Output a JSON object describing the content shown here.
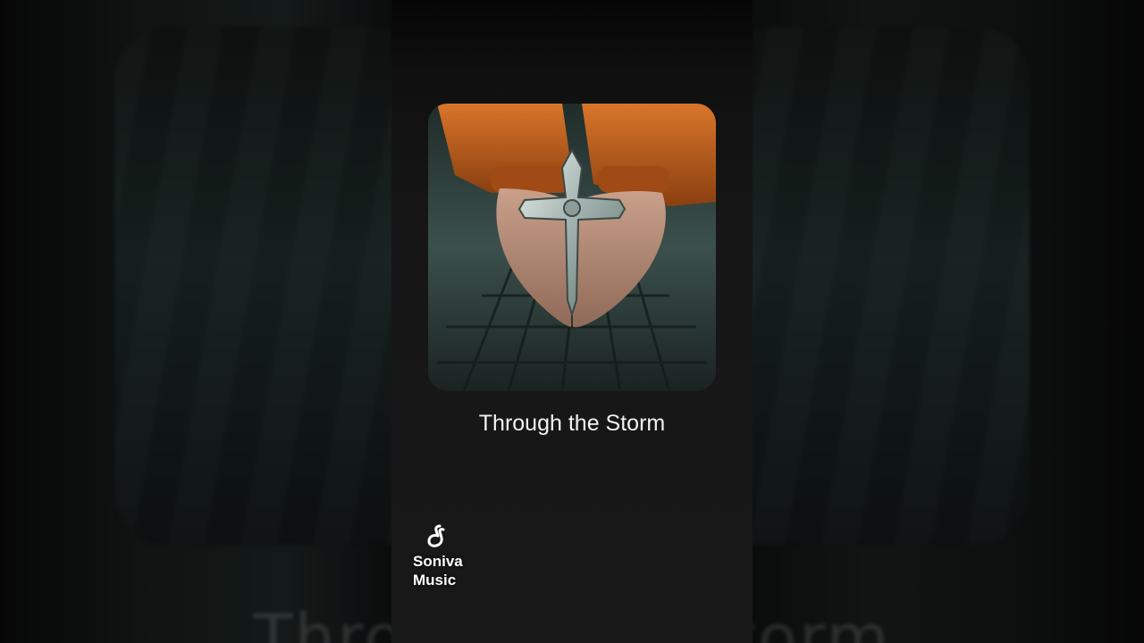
{
  "song": {
    "title": "Through the Storm"
  },
  "watermark": {
    "brand_line1": "Soniva",
    "brand_line2": "Music",
    "icon": "music-note-logo-icon"
  },
  "backdrop": {
    "blurred_title": "Through the Storm"
  },
  "cover_art": {
    "description_icon": "hands-holding-cross-image"
  },
  "colors": {
    "sleeve_orange": "#c2651e",
    "cross_silver": "#b9c6c2",
    "background_dark": "#161616"
  }
}
